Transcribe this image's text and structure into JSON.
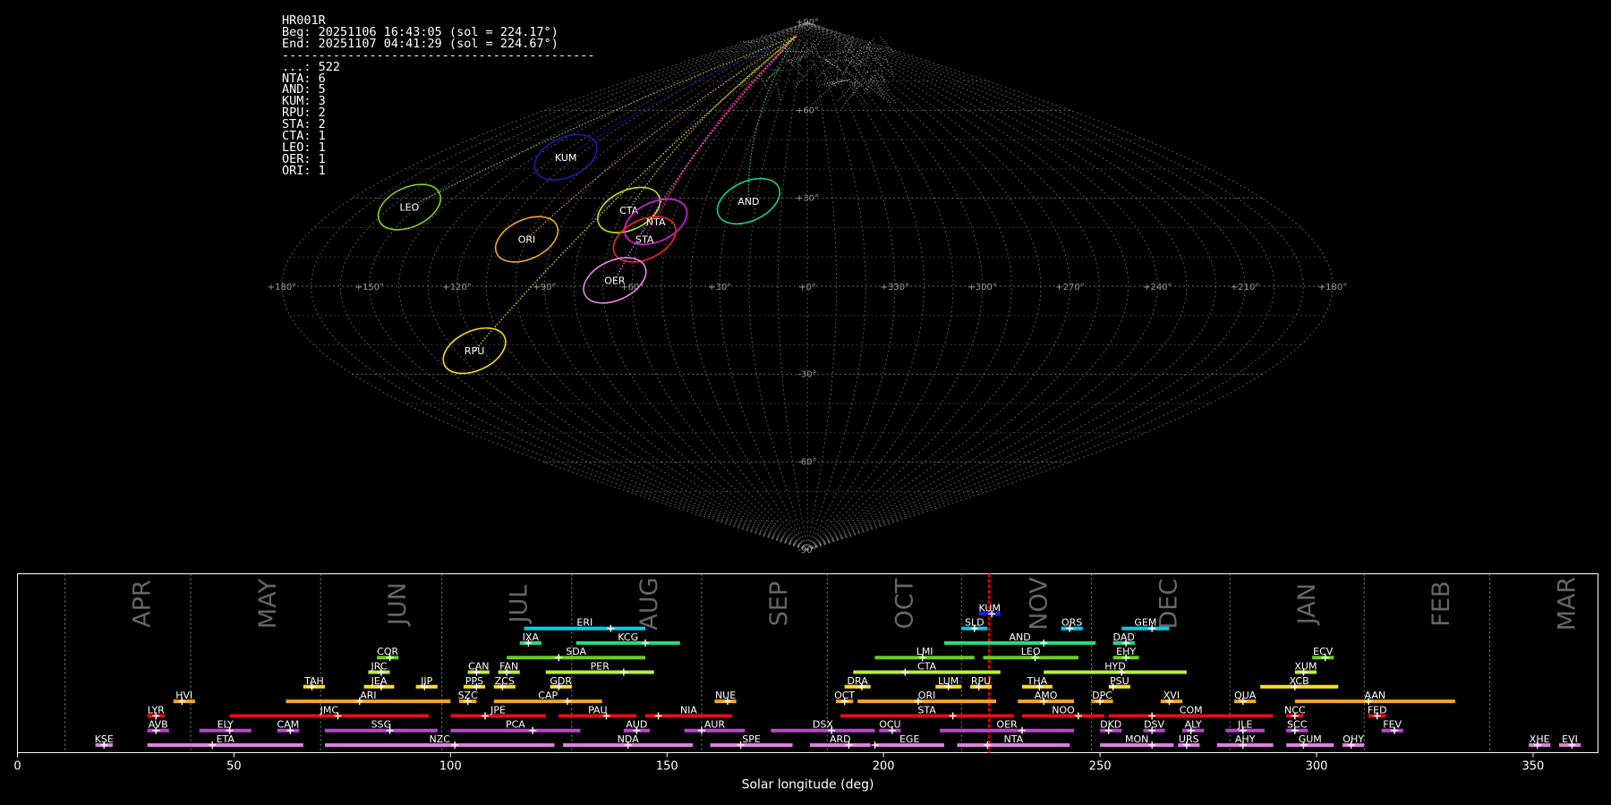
{
  "info": {
    "station": "HR001R",
    "begin": "Beg: 20251106 16:43:05 (sol = 224.17°)",
    "end": "End: 20251107 04:41:29 (sol = 224.67°)",
    "rule": "-------------------------------------------",
    "counts": [
      "...: 522",
      "NTA: 6",
      "AND: 5",
      "KUM: 3",
      "RPU: 2",
      "STA: 2",
      "CTA: 1",
      "LEO: 1",
      "OER: 1",
      "ORI: 1"
    ]
  },
  "sky": {
    "meridian_labels": [
      "+180°",
      "+150°",
      "+120°",
      "+90°",
      "+60°",
      "+30°",
      "+0°",
      "+330°",
      "+300°",
      "+270°",
      "+240°",
      "+210°",
      "+180°"
    ],
    "parallel_labels": [
      "+90°",
      "+60°",
      "+30°",
      "-30°",
      "-60°",
      "-90°"
    ],
    "radiants": [
      {
        "code": "KUM",
        "color": "#1c1cb4",
        "lon": 115,
        "lat": 44
      },
      {
        "code": "LEO",
        "color": "#7ed321",
        "lon": 153,
        "lat": 27
      },
      {
        "code": "ORI",
        "color": "#f5a623",
        "lon": 100,
        "lat": 16
      },
      {
        "code": "CTA",
        "color": "#b5e61d",
        "lon": 68,
        "lat": 26
      },
      {
        "code": "NTA",
        "color": "#e020e0",
        "lon": 56,
        "lat": 22
      },
      {
        "code": "STA",
        "color": "#ff2020",
        "lon": 58,
        "lat": 16
      },
      {
        "code": "AND",
        "color": "#20d070",
        "lon": 23,
        "lat": 29
      },
      {
        "code": "OER",
        "color": "#ee82ee",
        "lon": 66,
        "lat": 2
      },
      {
        "code": "RPU",
        "color": "#ffe000",
        "lon": 123,
        "lat": -22
      }
    ]
  },
  "chart_data": {
    "type": "timeline",
    "xlabel": "Solar longitude (deg)",
    "xlim": [
      0,
      365
    ],
    "x_ticks": [
      0,
      50,
      100,
      150,
      200,
      250,
      300,
      350
    ],
    "current_sol": 224.4,
    "months": [
      {
        "label": "APR",
        "start": 11
      },
      {
        "label": "MAY",
        "start": 40
      },
      {
        "label": "JUN",
        "start": 70
      },
      {
        "label": "JUL",
        "start": 98
      },
      {
        "label": "AUG",
        "start": 128
      },
      {
        "label": "SEP",
        "start": 158
      },
      {
        "label": "OCT",
        "start": 187
      },
      {
        "label": "NOV",
        "start": 218
      },
      {
        "label": "DEC",
        "start": 248
      },
      {
        "label": "JAN",
        "start": 280
      },
      {
        "label": "FEB",
        "start": 311
      },
      {
        "label": "MAR",
        "start": 340
      }
    ],
    "showers": [
      {
        "code": "KUM",
        "start": 222,
        "end": 227,
        "peak": 225,
        "row": 9,
        "color": "#1c1cff"
      },
      {
        "code": "ERI",
        "start": 117,
        "end": 145,
        "peak": 137,
        "row": 8,
        "color": "#00d0f0"
      },
      {
        "code": "SLD",
        "start": 218,
        "end": 224,
        "peak": 221,
        "row": 8,
        "color": "#00d0f0"
      },
      {
        "code": "ORS",
        "start": 241,
        "end": 246,
        "peak": 243,
        "row": 8,
        "color": "#00d0f0"
      },
      {
        "code": "GEM",
        "start": 255,
        "end": 266,
        "peak": 262,
        "row": 8,
        "color": "#00d0f0"
      },
      {
        "code": "IXA",
        "start": 116,
        "end": 121,
        "peak": 118,
        "row": 7,
        "color": "#20e080"
      },
      {
        "code": "KCG",
        "start": 129,
        "end": 153,
        "peak": 145,
        "row": 7,
        "color": "#20e080"
      },
      {
        "code": "AND",
        "start": 214,
        "end": 249,
        "peak": 237,
        "row": 7,
        "color": "#20e080"
      },
      {
        "code": "DAD",
        "start": 253,
        "end": 258,
        "peak": 256,
        "row": 7,
        "color": "#20e080"
      },
      {
        "code": "COR",
        "start": 83,
        "end": 88,
        "peak": 86,
        "row": 6,
        "color": "#6ccc20"
      },
      {
        "code": "SDA",
        "start": 113,
        "end": 145,
        "peak": 125,
        "row": 6,
        "color": "#6ccc20"
      },
      {
        "code": "LMI",
        "start": 198,
        "end": 221,
        "peak": 209,
        "row": 6,
        "color": "#6ccc20"
      },
      {
        "code": "LEO",
        "start": 223,
        "end": 245,
        "peak": 235,
        "row": 6,
        "color": "#6ccc20"
      },
      {
        "code": "EHY",
        "start": 253,
        "end": 259,
        "peak": 256,
        "row": 6,
        "color": "#6ccc20"
      },
      {
        "code": "ECV",
        "start": 299,
        "end": 304,
        "peak": 302,
        "row": 6,
        "color": "#6ccc20"
      },
      {
        "code": "JRC",
        "start": 81,
        "end": 86,
        "peak": 84,
        "row": 5,
        "color": "#b8f040"
      },
      {
        "code": "CAN",
        "start": 104,
        "end": 109,
        "peak": 106,
        "row": 5,
        "color": "#b8f040"
      },
      {
        "code": "FAN",
        "start": 111,
        "end": 116,
        "peak": 113,
        "row": 5,
        "color": "#b8f040"
      },
      {
        "code": "PER",
        "start": 122,
        "end": 147,
        "peak": 140,
        "row": 5,
        "color": "#b8f040"
      },
      {
        "code": "CTA",
        "start": 193,
        "end": 227,
        "peak": 205,
        "row": 5,
        "color": "#b8f040"
      },
      {
        "code": "HYD",
        "start": 237,
        "end": 270,
        "peak": 255,
        "row": 5,
        "color": "#b8f040"
      },
      {
        "code": "XUM",
        "start": 295,
        "end": 300,
        "peak": 297,
        "row": 5,
        "color": "#b8f040"
      },
      {
        "code": "TAH",
        "start": 66,
        "end": 71,
        "peak": 68,
        "row": 4,
        "color": "#ffe020"
      },
      {
        "code": "JEA",
        "start": 80,
        "end": 87,
        "peak": 84,
        "row": 4,
        "color": "#ffe020"
      },
      {
        "code": "JIP",
        "start": 92,
        "end": 97,
        "peak": 94,
        "row": 4,
        "color": "#ffe020"
      },
      {
        "code": "PPS",
        "start": 103,
        "end": 108,
        "peak": 106,
        "row": 4,
        "color": "#ffe020"
      },
      {
        "code": "ZCS",
        "start": 110,
        "end": 115,
        "peak": 112,
        "row": 4,
        "color": "#ffe020"
      },
      {
        "code": "GDR",
        "start": 123,
        "end": 128,
        "peak": 125,
        "row": 4,
        "color": "#ffe020"
      },
      {
        "code": "DRA",
        "start": 191,
        "end": 197,
        "peak": 195,
        "row": 4,
        "color": "#ffe020"
      },
      {
        "code": "LUM",
        "start": 212,
        "end": 218,
        "peak": 215,
        "row": 4,
        "color": "#ffe020"
      },
      {
        "code": "RPU",
        "start": 220,
        "end": 225,
        "peak": 222,
        "row": 4,
        "color": "#ffe020"
      },
      {
        "code": "THA",
        "start": 232,
        "end": 239,
        "peak": 236,
        "row": 4,
        "color": "#ffe020"
      },
      {
        "code": "PSU",
        "start": 252,
        "end": 257,
        "peak": 253,
        "row": 4,
        "color": "#ffe020"
      },
      {
        "code": "XCB",
        "start": 287,
        "end": 305,
        "peak": 295,
        "row": 4,
        "color": "#ffe020"
      },
      {
        "code": "HVI",
        "start": 36,
        "end": 41,
        "peak": 38,
        "row": 3,
        "color": "#f5a623"
      },
      {
        "code": "ARI",
        "start": 62,
        "end": 100,
        "peak": 79,
        "row": 3,
        "color": "#f5a623"
      },
      {
        "code": "SZC",
        "start": 102,
        "end": 106,
        "peak": 104,
        "row": 3,
        "color": "#f5a623"
      },
      {
        "code": "CAP",
        "start": 110,
        "end": 135,
        "peak": 127,
        "row": 3,
        "color": "#f5a623"
      },
      {
        "code": "NUE",
        "start": 161,
        "end": 166,
        "peak": 164,
        "row": 3,
        "color": "#f5a623"
      },
      {
        "code": "OCT",
        "start": 189,
        "end": 193,
        "peak": 191,
        "row": 3,
        "color": "#f5a623"
      },
      {
        "code": "ORI",
        "start": 194,
        "end": 226,
        "peak": 208,
        "row": 3,
        "color": "#f5a623"
      },
      {
        "code": "AMO",
        "start": 231,
        "end": 244,
        "peak": 237,
        "row": 3,
        "color": "#f5a623"
      },
      {
        "code": "DPC",
        "start": 248,
        "end": 253,
        "peak": 250,
        "row": 3,
        "color": "#f5a623"
      },
      {
        "code": "XVI",
        "start": 264,
        "end": 269,
        "peak": 266,
        "row": 3,
        "color": "#f5a623"
      },
      {
        "code": "QUA",
        "start": 281,
        "end": 286,
        "peak": 283,
        "row": 3,
        "color": "#f5a623"
      },
      {
        "code": "AAN",
        "start": 295,
        "end": 332,
        "peak": 312,
        "row": 3,
        "color": "#f5a623"
      },
      {
        "code": "LYR",
        "start": 30,
        "end": 34,
        "peak": 32,
        "row": 2,
        "color": "#e01010"
      },
      {
        "code": "JMC",
        "start": 49,
        "end": 95,
        "peak": 74,
        "row": 2,
        "color": "#e01010"
      },
      {
        "code": "JPE",
        "start": 100,
        "end": 122,
        "peak": 108,
        "row": 2,
        "color": "#e01010"
      },
      {
        "code": "PAU",
        "start": 125,
        "end": 143,
        "peak": 136,
        "row": 2,
        "color": "#e01010"
      },
      {
        "code": "NIA",
        "start": 145,
        "end": 165,
        "peak": 148,
        "row": 2,
        "color": "#e01010"
      },
      {
        "code": "STA",
        "start": 190,
        "end": 230,
        "peak": 216,
        "row": 2,
        "color": "#e01010"
      },
      {
        "code": "NOO",
        "start": 232,
        "end": 251,
        "peak": 245,
        "row": 2,
        "color": "#e01010"
      },
      {
        "code": "COM",
        "start": 252,
        "end": 290,
        "peak": 262,
        "row": 2,
        "color": "#e01010"
      },
      {
        "code": "NCC",
        "start": 293,
        "end": 297,
        "peak": 295,
        "row": 2,
        "color": "#e01010"
      },
      {
        "code": "FED",
        "start": 312,
        "end": 316,
        "peak": 314,
        "row": 2,
        "color": "#e01010"
      },
      {
        "code": "AVB",
        "start": 30,
        "end": 35,
        "peak": 32,
        "row": 1,
        "color": "#c040d8"
      },
      {
        "code": "ELY",
        "start": 42,
        "end": 54,
        "peak": 49,
        "row": 1,
        "color": "#c040d8"
      },
      {
        "code": "CAM",
        "start": 60,
        "end": 65,
        "peak": 63,
        "row": 1,
        "color": "#c040d8"
      },
      {
        "code": "SSG",
        "start": 71,
        "end": 97,
        "peak": 86,
        "row": 1,
        "color": "#c040d8"
      },
      {
        "code": "PCA",
        "start": 100,
        "end": 130,
        "peak": 119,
        "row": 1,
        "color": "#c040d8"
      },
      {
        "code": "AUD",
        "start": 140,
        "end": 146,
        "peak": 143,
        "row": 1,
        "color": "#c040d8"
      },
      {
        "code": "AUR",
        "start": 154,
        "end": 168,
        "peak": 158,
        "row": 1,
        "color": "#c040d8"
      },
      {
        "code": "DSX",
        "start": 174,
        "end": 198,
        "peak": 188,
        "row": 1,
        "color": "#c040d8"
      },
      {
        "code": "OCU",
        "start": 199,
        "end": 204,
        "peak": 202,
        "row": 1,
        "color": "#c040d8"
      },
      {
        "code": "OER",
        "start": 213,
        "end": 244,
        "peak": 232,
        "row": 1,
        "color": "#c040d8"
      },
      {
        "code": "DKD",
        "start": 250,
        "end": 255,
        "peak": 252,
        "row": 1,
        "color": "#c040d8"
      },
      {
        "code": "DSV",
        "start": 260,
        "end": 265,
        "peak": 262,
        "row": 1,
        "color": "#c040d8"
      },
      {
        "code": "ALY",
        "start": 269,
        "end": 274,
        "peak": 271,
        "row": 1,
        "color": "#c040d8"
      },
      {
        "code": "JLE",
        "start": 279,
        "end": 288,
        "peak": 283,
        "row": 1,
        "color": "#c040d8"
      },
      {
        "code": "SCC",
        "start": 293,
        "end": 298,
        "peak": 295,
        "row": 1,
        "color": "#c040d8"
      },
      {
        "code": "FEV",
        "start": 315,
        "end": 320,
        "peak": 318,
        "row": 1,
        "color": "#c040d8"
      },
      {
        "code": "KSE",
        "start": 18,
        "end": 22,
        "peak": 20,
        "row": 0,
        "color": "#e080e0"
      },
      {
        "code": "ETA",
        "start": 30,
        "end": 66,
        "peak": 45,
        "row": 0,
        "color": "#e080e0"
      },
      {
        "code": "NZC",
        "start": 71,
        "end": 124,
        "peak": 101,
        "row": 0,
        "color": "#e080e0"
      },
      {
        "code": "NDA",
        "start": 126,
        "end": 156,
        "peak": 141,
        "row": 0,
        "color": "#e080e0"
      },
      {
        "code": "SPE",
        "start": 160,
        "end": 179,
        "peak": 167,
        "row": 0,
        "color": "#e080e0"
      },
      {
        "code": "ARD",
        "start": 183,
        "end": 197,
        "peak": 192,
        "row": 0,
        "color": "#e080e0"
      },
      {
        "code": "EGE",
        "start": 198,
        "end": 214,
        "peak": 198,
        "row": 0,
        "color": "#e080e0"
      },
      {
        "code": "NTA",
        "start": 217,
        "end": 243,
        "peak": 224,
        "row": 0,
        "color": "#e080e0"
      },
      {
        "code": "MON",
        "start": 250,
        "end": 267,
        "peak": 262,
        "row": 0,
        "color": "#e080e0"
      },
      {
        "code": "URS",
        "start": 268,
        "end": 273,
        "peak": 270,
        "row": 0,
        "color": "#e080e0"
      },
      {
        "code": "AHY",
        "start": 277,
        "end": 290,
        "peak": 283,
        "row": 0,
        "color": "#e080e0"
      },
      {
        "code": "GUM",
        "start": 293,
        "end": 304,
        "peak": 297,
        "row": 0,
        "color": "#e080e0"
      },
      {
        "code": "OHY",
        "start": 306,
        "end": 311,
        "peak": 308,
        "row": 0,
        "color": "#e080e0"
      },
      {
        "code": "XHE",
        "start": 349,
        "end": 354,
        "peak": 351,
        "row": 0,
        "color": "#e080e0"
      },
      {
        "code": "EVI",
        "start": 356,
        "end": 361,
        "peak": 359,
        "row": 0,
        "color": "#e080e0"
      }
    ]
  }
}
